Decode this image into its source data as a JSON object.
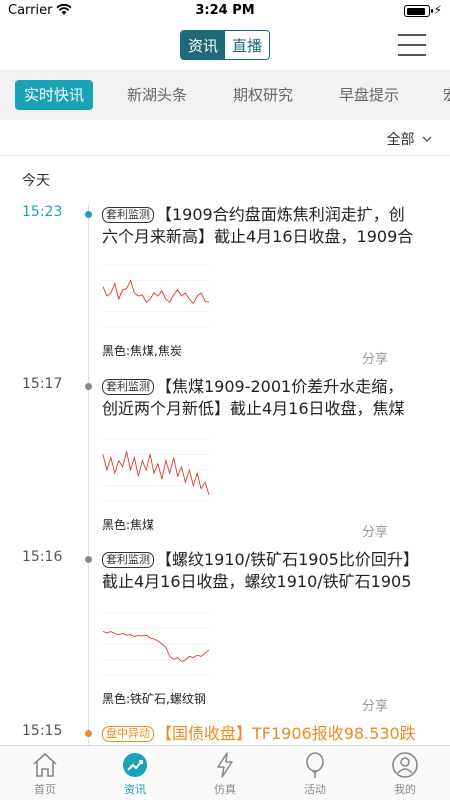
{
  "status_bar": {
    "carrier": "Carrier",
    "time": "3:24 PM"
  },
  "header": {
    "segments": [
      "资讯",
      "直播"
    ],
    "active_segment": 0
  },
  "tabs": [
    "实时快讯",
    "新湖头条",
    "期权研究",
    "早盘提示",
    "宏"
  ],
  "filter": {
    "label": "全部",
    "icon": "chevron-down-icon"
  },
  "feed": {
    "day_label": "今天",
    "items": [
      {
        "time": "15:23",
        "tag": "套利监测",
        "text": "【1909合约盘面炼焦利润走扩，创六个月来新高】截止4月16日收盘，1909合约...",
        "category": "黑色:焦煤,焦炭",
        "share": "分享",
        "chart": [
          0.35,
          0.5,
          0.45,
          0.3,
          0.55,
          0.4,
          0.38,
          0.25,
          0.45,
          0.5,
          0.48,
          0.6,
          0.55,
          0.45,
          0.5,
          0.42,
          0.55,
          0.6,
          0.48,
          0.4,
          0.5,
          0.45,
          0.55,
          0.62,
          0.5,
          0.45,
          0.58,
          0.6
        ]
      },
      {
        "time": "15:17",
        "tag": "套利监测",
        "text": "【焦煤1909-2001价差升水走缩，创近两个月新低】截止4月16日收盘，焦煤190...",
        "category": "黑色:焦煤",
        "share": "分享",
        "chart": [
          0.25,
          0.5,
          0.3,
          0.55,
          0.35,
          0.45,
          0.2,
          0.5,
          0.3,
          0.6,
          0.35,
          0.5,
          0.25,
          0.55,
          0.4,
          0.65,
          0.35,
          0.55,
          0.3,
          0.6,
          0.45,
          0.7,
          0.5,
          0.75,
          0.55,
          0.8,
          0.7,
          0.9
        ]
      },
      {
        "time": "15:16",
        "tag": "套利监测",
        "text": "【螺纹1910/铁矿石1905比价回升】截止4月16日收盘，螺纹1910/铁矿石1905比...",
        "category": "黑色:铁矿石,螺纹钢",
        "share": "分享",
        "chart": [
          0.3,
          0.32,
          0.3,
          0.33,
          0.35,
          0.33,
          0.36,
          0.35,
          0.38,
          0.36,
          0.37,
          0.36,
          0.4,
          0.42,
          0.45,
          0.5,
          0.55,
          0.7,
          0.75,
          0.72,
          0.78,
          0.76,
          0.7,
          0.72,
          0.68,
          0.7,
          0.65,
          0.6
        ]
      },
      {
        "time": "15:15",
        "tag": "盘中异动",
        "text": "【国债收盘】TF1906报收98.530跌",
        "category": "",
        "share": ""
      }
    ]
  },
  "bottom_nav": [
    {
      "label": "首页",
      "icon": "home-icon"
    },
    {
      "label": "资讯",
      "icon": "news-icon"
    },
    {
      "label": "仿真",
      "icon": "lightning-icon"
    },
    {
      "label": "活动",
      "icon": "balloon-icon"
    },
    {
      "label": "我的",
      "icon": "user-icon"
    }
  ],
  "colors": {
    "accent": "#1aa2b7",
    "brand_dark": "#1f6a78",
    "alert": "#f08a1e",
    "chart_line": "#e03a2f"
  }
}
